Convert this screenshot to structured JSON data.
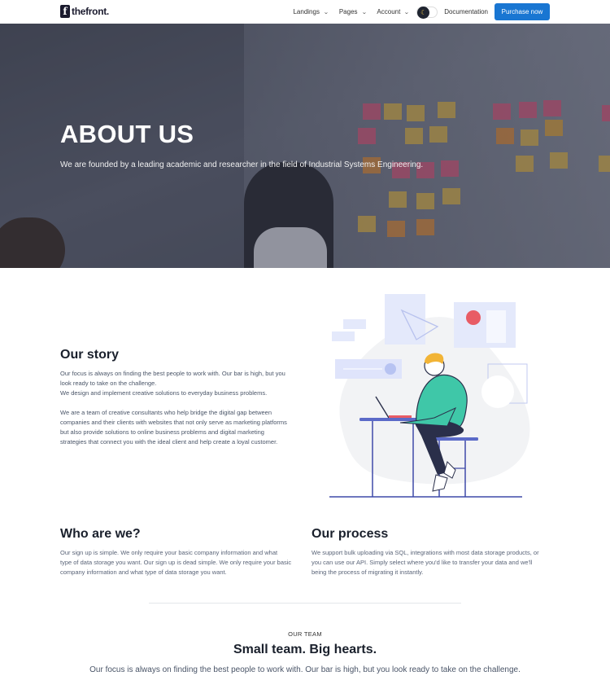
{
  "header": {
    "logo_letter": "f",
    "logo_text_bold": "the",
    "logo_text_rest": "front.",
    "nav": [
      {
        "label": "Landings"
      },
      {
        "label": "Pages"
      },
      {
        "label": "Account"
      }
    ],
    "toggle_icon": "moon-icon",
    "documentation": "Documentation",
    "purchase": "Purchase now",
    "accent": "#1976d2"
  },
  "hero": {
    "title": "ABOUT US",
    "subtitle": "We are founded by a leading academic and researcher in the field of Industrial Systems Engineering."
  },
  "story": {
    "title": "Our story",
    "p1_line1": "Our focus is always on finding the best people to work with. Our bar is high, but you",
    "p1_line2": "look ready to take on the challenge.",
    "p1_line3": "We design and implement creative solutions to everyday business problems.",
    "p2_line1": "We are a team of creative consultants who help bridge the digital gap between",
    "p2_line2": "companies and their clients with websites that not only serve as marketing platforms",
    "p2_line3": "but also provide solutions to online business problems and digital marketing",
    "p2_line4": "strategies that connect you with the ideal client and help create a loyal customer."
  },
  "who": {
    "title": "Who are we?",
    "line1": "Our sign up is simple. We only require your basic company information and what",
    "line2": "type of data storage you want. Our sign up is dead simple. We only require your basic",
    "line3": "company information and what type of data storage you want."
  },
  "process": {
    "title": "Our process",
    "line1": "We support bulk uploading via SQL, integrations with most data storage products, or",
    "line2": "you can use our API. Simply select where you'd like to transfer your data and we'll",
    "line3": "being the process of migrating it instantly."
  },
  "team": {
    "eyebrow": "OUR TEAM",
    "title": "Small team. Big hearts.",
    "subtitle": "Our focus is always on finding the best people to work with. Our bar is high, but you look ready to take on the challenge."
  }
}
